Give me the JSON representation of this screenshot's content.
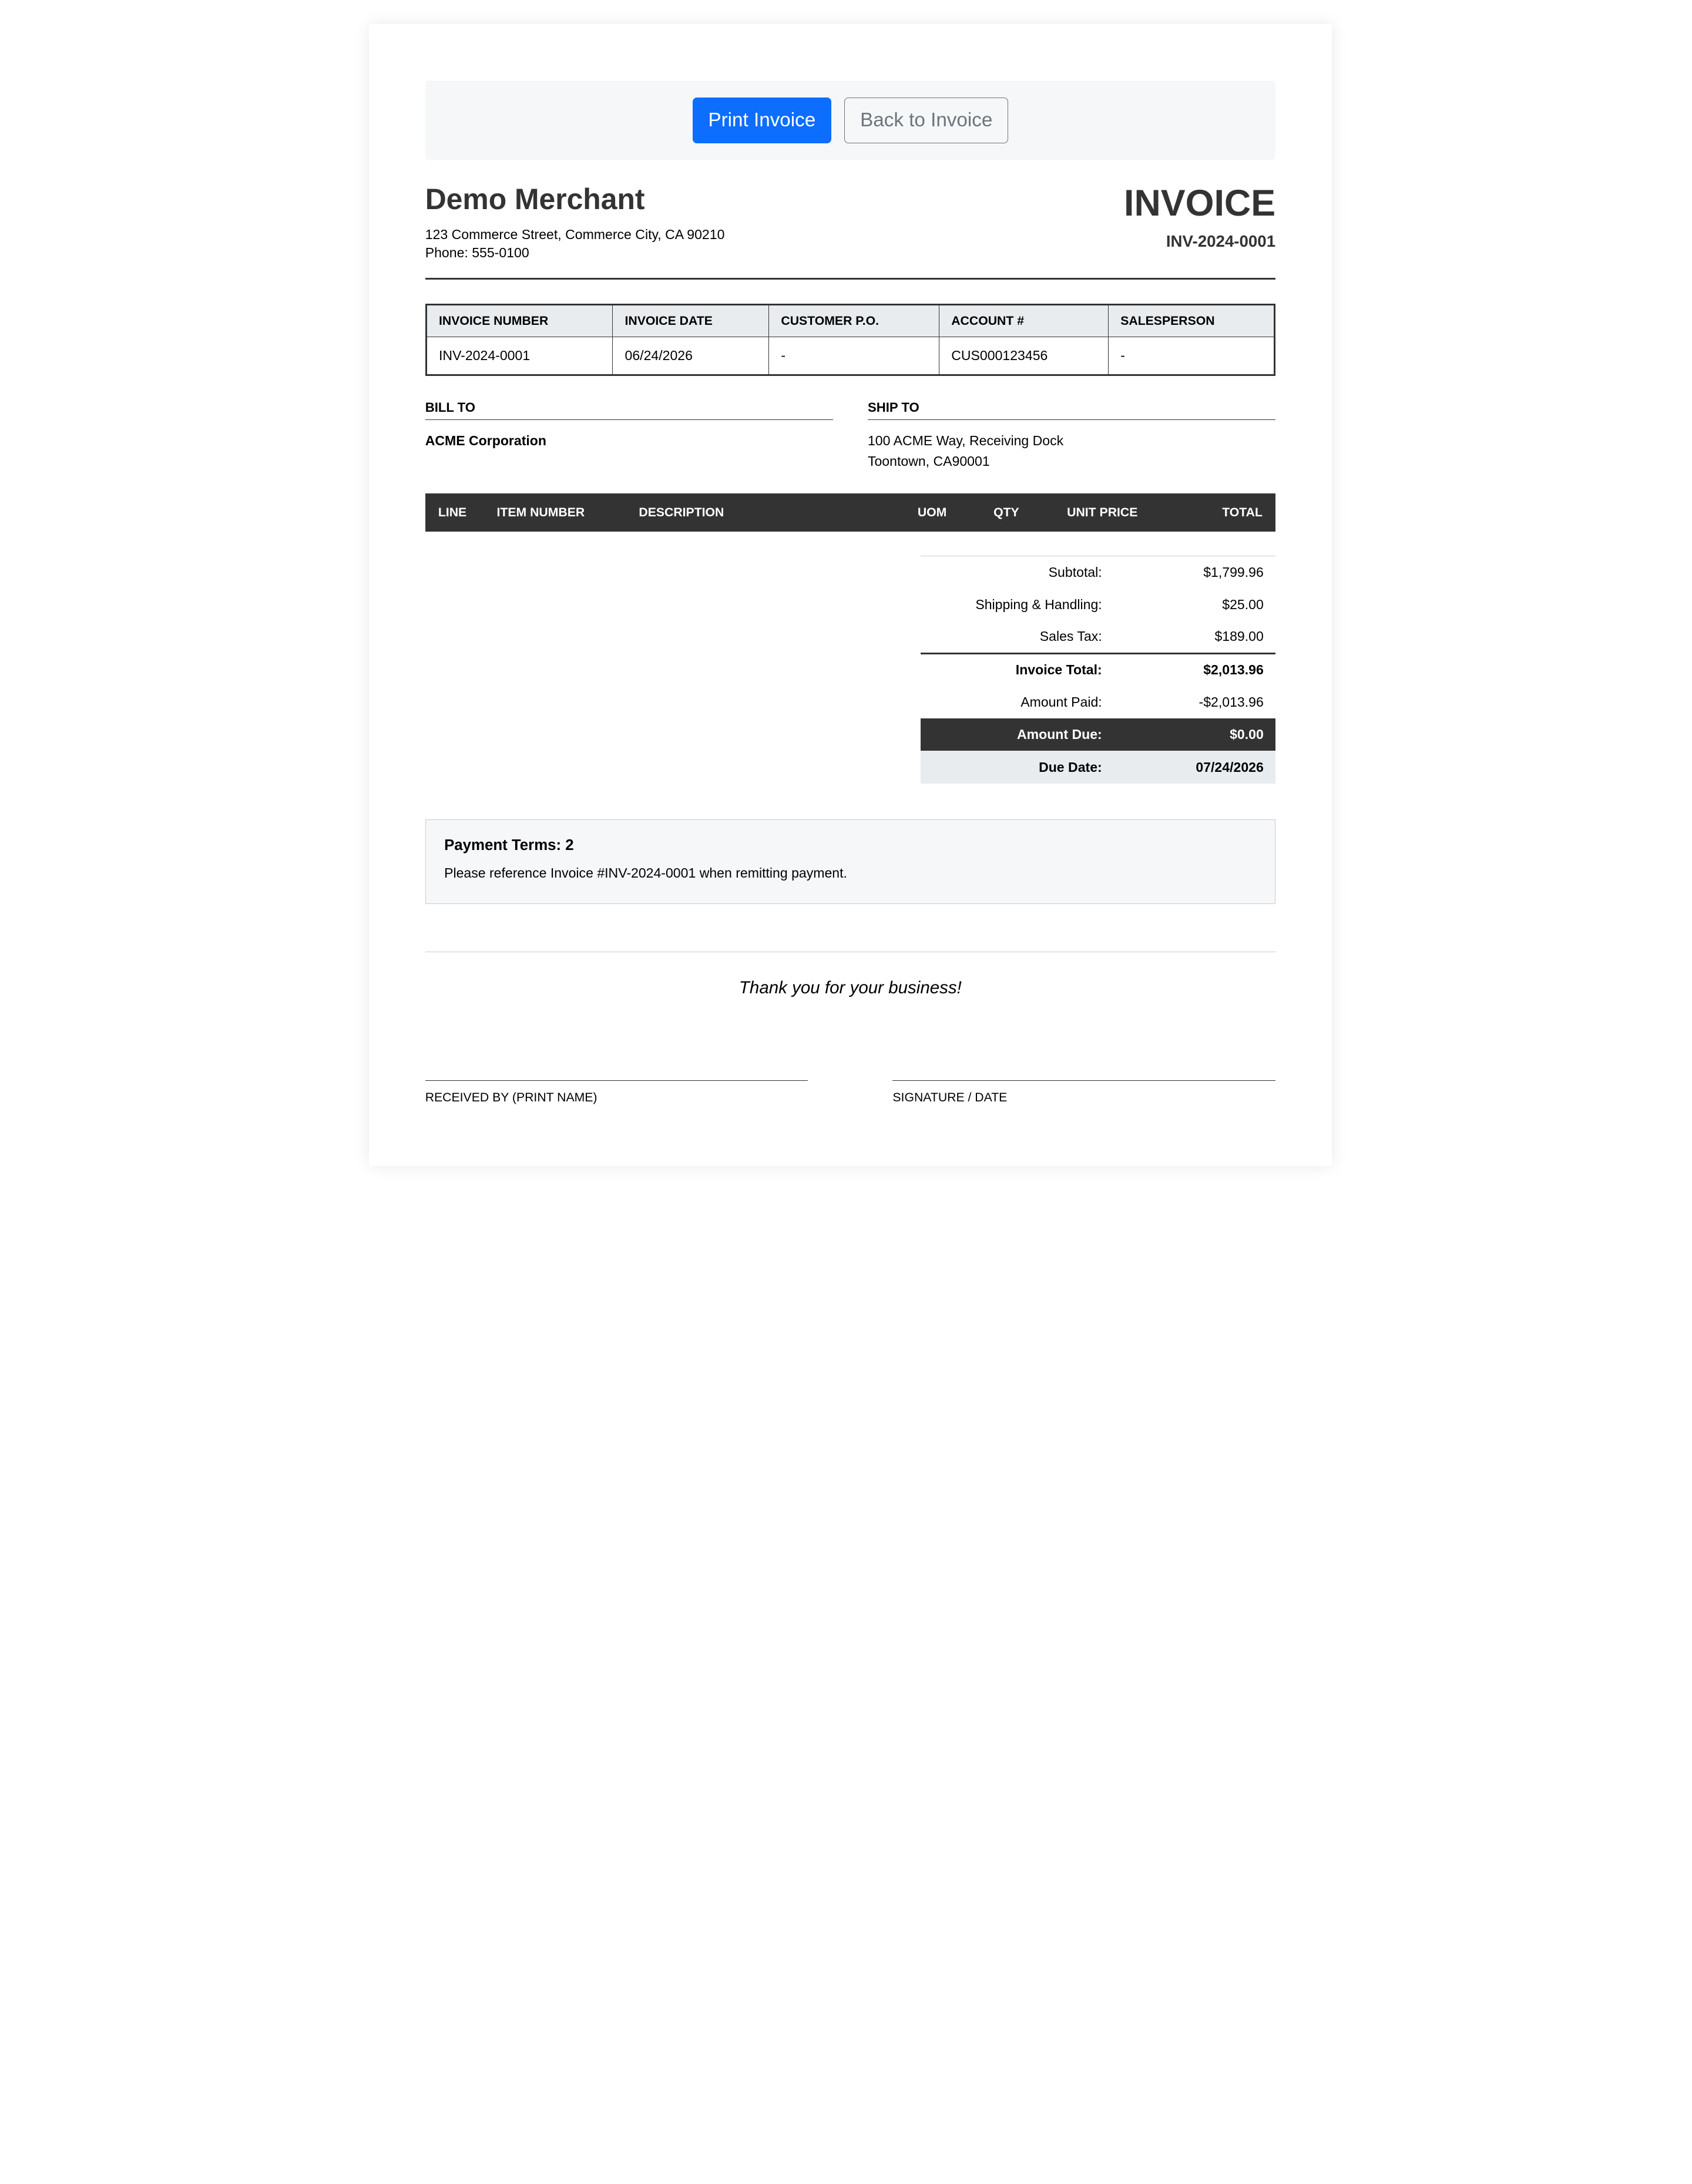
{
  "toolbar": {
    "print_label": "Print Invoice",
    "back_label": "Back to Invoice"
  },
  "merchant": {
    "name": "Demo Merchant",
    "address": "123 Commerce Street, Commerce City, CA 90210",
    "phone": "Phone: 555-0100"
  },
  "invoice": {
    "title": "INVOICE",
    "number": "INV-2024-0001"
  },
  "meta_table": {
    "headers": [
      "INVOICE NUMBER",
      "INVOICE DATE",
      "CUSTOMER P.O.",
      "ACCOUNT #",
      "SALESPERSON"
    ],
    "values": [
      "INV-2024-0001",
      "06/24/2026",
      "-",
      "CUS000123456",
      "-"
    ]
  },
  "bill_to": {
    "heading": "BILL TO",
    "name": "ACME Corporation"
  },
  "ship_to": {
    "heading": "SHIP TO",
    "line1": "100 ACME Way, Receiving Dock",
    "line2": "Toontown, CA90001"
  },
  "items_table": {
    "headers": [
      "LINE",
      "ITEM NUMBER",
      "DESCRIPTION",
      "UOM",
      "QTY",
      "UNIT PRICE",
      "TOTAL"
    ],
    "rows": []
  },
  "totals": {
    "subtotal_label": "Subtotal:",
    "subtotal": "$1,799.96",
    "shipping_label": "Shipping & Handling:",
    "shipping": "$25.00",
    "tax_label": "Sales Tax:",
    "tax": "$189.00",
    "invoice_total_label": "Invoice Total:",
    "invoice_total": "$2,013.96",
    "paid_label": "Amount Paid:",
    "paid": "-$2,013.96",
    "due_label": "Amount Due:",
    "due": "$0.00",
    "due_date_label": "Due Date:",
    "due_date": "07/24/2026"
  },
  "terms": {
    "title": "Payment Terms: 2",
    "note": "Please reference Invoice #INV-2024-0001 when remitting payment."
  },
  "footer": {
    "thanks": "Thank you for your business!",
    "received_by": "RECEIVED BY (PRINT NAME)",
    "signature": "SIGNATURE / DATE"
  },
  "colors": {
    "primary_button": "#0d6efd",
    "dark_header": "#333333",
    "light_bg": "#e9ecef"
  }
}
